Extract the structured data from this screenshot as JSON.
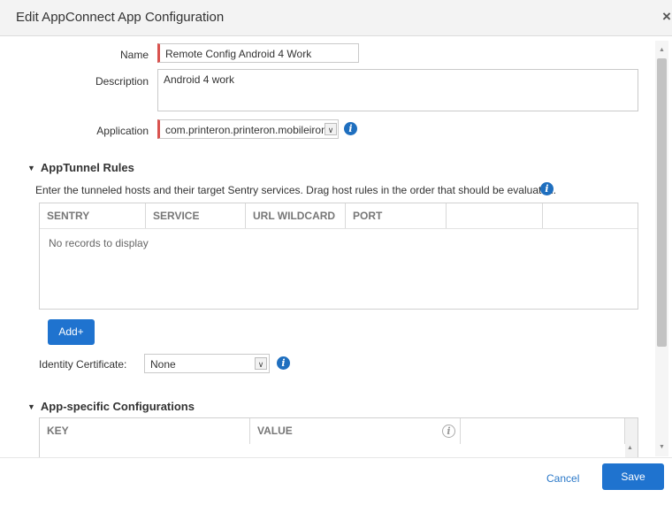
{
  "dialog": {
    "title": "Edit AppConnect App Configuration",
    "close_glyph": "×"
  },
  "form": {
    "name_label": "Name",
    "name_value": "Remote Config Android 4 Work",
    "description_label": "Description",
    "description_value": "Android 4 work",
    "application_label": "Application",
    "application_value": "com.printeron.printeron.mobileiron",
    "info_glyph": "i",
    "select_arrow_glyph": "∨"
  },
  "apptunnel": {
    "title": "AppTunnel Rules",
    "collapse_glyph": "▼",
    "hint": "Enter the tunneled hosts and their target Sentry services. Drag host rules in the order that should be evaluated.",
    "columns": [
      "SENTRY",
      "SERVICE",
      "URL WILDCARD",
      "PORT",
      "",
      ""
    ],
    "empty_text": "No records to display",
    "add_label": "Add+"
  },
  "identity": {
    "label": "Identity Certificate:",
    "value": "None"
  },
  "app_specific": {
    "title": "App-specific Configurations",
    "columns": [
      "KEY",
      "VALUE",
      ""
    ]
  },
  "footer": {
    "cancel_label": "Cancel",
    "save_label": "Save"
  },
  "scrollbar": {
    "up_glyph": "▲",
    "down_glyph": "▼"
  },
  "colors": {
    "accent": "#1f73cf",
    "required": "#d9534f",
    "link": "#2a78c8"
  }
}
